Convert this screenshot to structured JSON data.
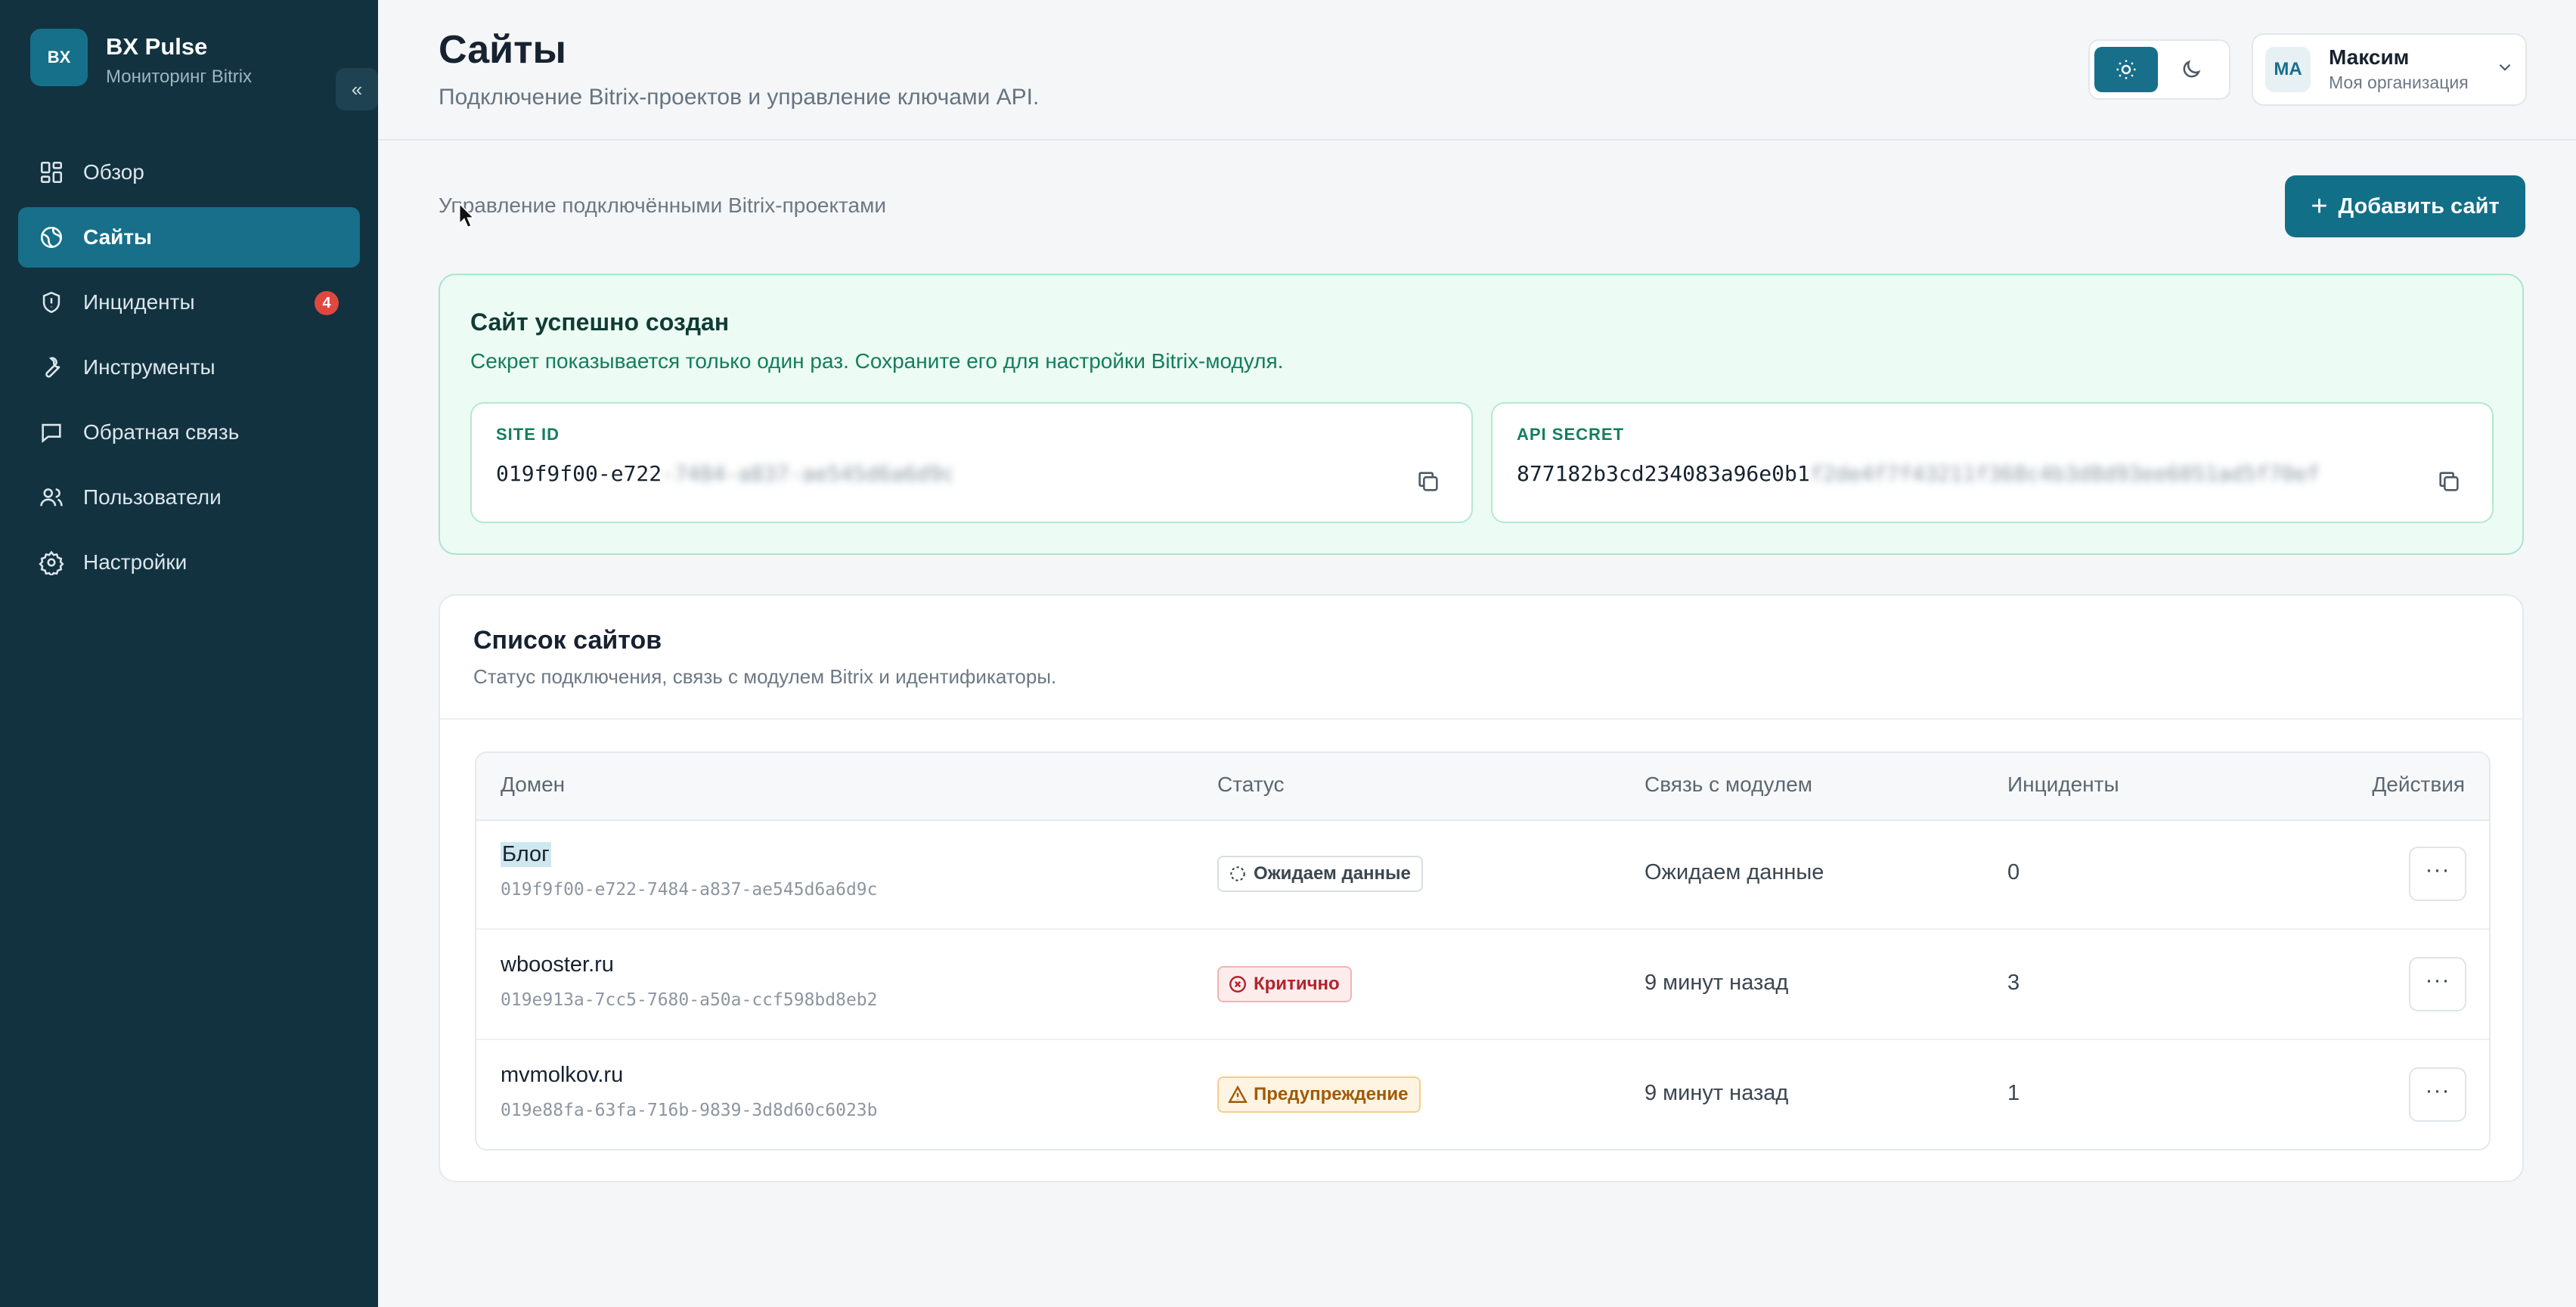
{
  "brand": {
    "logo_text": "BX",
    "name": "BX Pulse",
    "subtitle": "Мониторинг Bitrix",
    "collapse_glyph": "«"
  },
  "sidebar": {
    "items": [
      {
        "label": "Обзор",
        "icon": "dashboard-icon",
        "active": false
      },
      {
        "label": "Сайты",
        "icon": "globe-icon",
        "active": true
      },
      {
        "label": "Инциденты",
        "icon": "shield-alert-icon",
        "active": false,
        "badge": "4"
      },
      {
        "label": "Инструменты",
        "icon": "wrench-icon",
        "active": false
      },
      {
        "label": "Обратная связь",
        "icon": "message-icon",
        "active": false
      },
      {
        "label": "Пользователи",
        "icon": "users-icon",
        "active": false
      },
      {
        "label": "Настройки",
        "icon": "gear-icon",
        "active": false
      }
    ]
  },
  "header": {
    "title": "Сайты",
    "subtitle": "Подключение Bitrix-проектов и управление ключами API.",
    "theme": {
      "active": "light"
    },
    "user": {
      "initials": "МА",
      "name": "Максим",
      "org": "Моя организация"
    }
  },
  "main": {
    "caption": "Управление подключёнными Bitrix-проектами",
    "add_button": {
      "plus": "+",
      "label": "Добавить сайт"
    },
    "success": {
      "title": "Сайт успешно создан",
      "text": "Секрет показывается только один раз. Сохраните его для настройки Bitrix-модуля.",
      "site_id": {
        "label": "SITE ID",
        "value": "019f9f00-e722",
        "masked": "-7484-a837-ae545d6a6d9c"
      },
      "api_secret": {
        "label": "API SECRET",
        "value": "877182b3cd234083a96e0b1",
        "masked": "f2de4f7f43211f368c4b3d8d93ee6051ad5f70ef"
      }
    },
    "list": {
      "title": "Список сайтов",
      "subtitle": "Статус подключения, связь с модулем Bitrix и идентификаторы.",
      "columns": {
        "domain": "Домен",
        "status": "Статус",
        "module": "Связь с модулем",
        "incidents": "Инциденты",
        "actions": "Действия"
      },
      "rows": [
        {
          "domain": "Блог",
          "id": "019f9f00-e722-7484-a837-ae545d6a6d9c",
          "status": "Ожидаем данные",
          "status_type": "waiting",
          "module": "Ожидаем данные",
          "incidents": "0",
          "actions": "···"
        },
        {
          "domain": "wbooster.ru",
          "id": "019e913a-7cc5-7680-a50a-ccf598bd8eb2",
          "status": "Критично",
          "status_type": "critical",
          "module": "9 минут назад",
          "incidents": "3",
          "actions": "···"
        },
        {
          "domain": "mvmolkov.ru",
          "id": "019e88fa-63fa-716b-9839-3d8d60c6023b",
          "status": "Предупреждение",
          "status_type": "warning",
          "module": "9 минут назад",
          "incidents": "1",
          "actions": "···"
        }
      ]
    }
  },
  "colors": {
    "sidebar_bg": "#123240",
    "accent": "#176f8a",
    "success_bg": "#ecfbf4",
    "critical": "#b4222a",
    "warning": "#a05a06",
    "badge": "#e0473f"
  }
}
